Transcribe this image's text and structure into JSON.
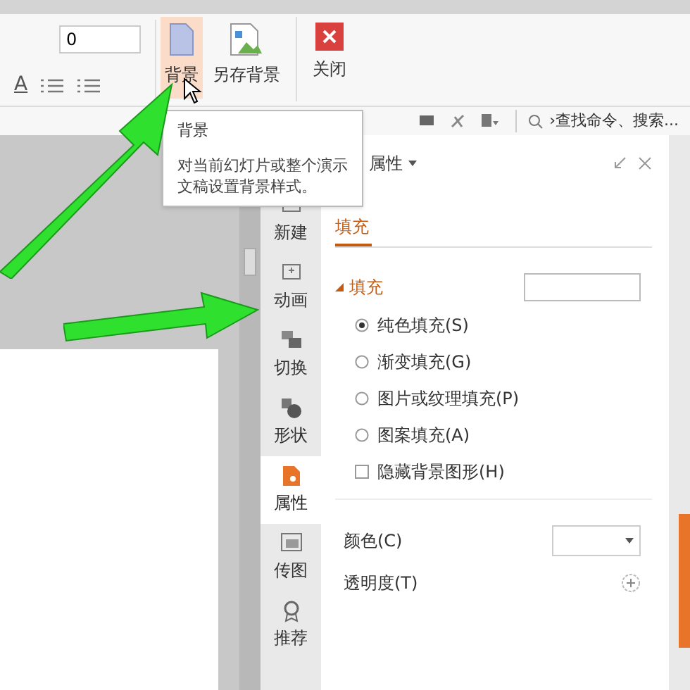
{
  "ribbon": {
    "font_size": "0",
    "font_color_glyph": "A",
    "buttons": [
      {
        "label": "背景",
        "kind": "page",
        "selected": true
      },
      {
        "label": "另存背景",
        "kind": "image",
        "selected": false
      },
      {
        "label": "关闭",
        "kind": "close",
        "selected": false
      }
    ]
  },
  "tooltip": {
    "title": "背景",
    "text": "对当前幻灯片或整个演示文稿设置背景样式。"
  },
  "search": {
    "text": "›查找命令、搜索..."
  },
  "side_tabs": [
    {
      "label": "新建",
      "selected": false
    },
    {
      "label": "动画",
      "selected": false
    },
    {
      "label": "切换",
      "selected": false
    },
    {
      "label": "形状",
      "selected": false
    },
    {
      "label": "属性",
      "selected": true
    },
    {
      "label": "传图",
      "selected": false
    },
    {
      "label": "推荐",
      "selected": false
    }
  ],
  "panel": {
    "title": "属性",
    "tab": "填充",
    "section": "填充",
    "options": [
      {
        "label": "纯色填充(S)",
        "kind": "radio",
        "checked": true
      },
      {
        "label": "渐变填充(G)",
        "kind": "radio",
        "checked": false
      },
      {
        "label": "图片或纹理填充(P)",
        "kind": "radio",
        "checked": false
      },
      {
        "label": "图案填充(A)",
        "kind": "radio",
        "checked": false
      },
      {
        "label": "隐藏背景图形(H)",
        "kind": "checkbox",
        "checked": false
      }
    ],
    "color_label": "颜色(C)",
    "transparency_label": "透明度(T)"
  }
}
